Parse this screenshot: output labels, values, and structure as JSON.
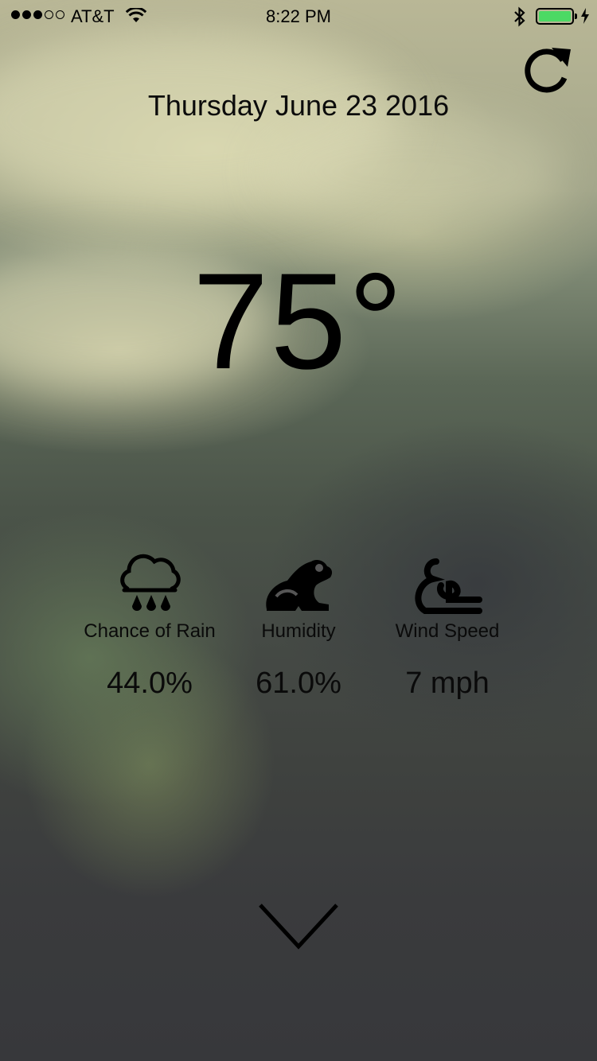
{
  "status_bar": {
    "signal_dots_filled": 3,
    "signal_dots_total": 5,
    "carrier": "AT&T",
    "time": "8:22 PM",
    "battery_level": 1.0,
    "battery_color": "#4cd964",
    "icons": [
      "wifi-icon",
      "bluetooth-icon",
      "battery-icon",
      "charging-bolt-icon"
    ]
  },
  "header": {
    "refresh_icon": "refresh-icon",
    "date": "Thursday June 23 2016"
  },
  "current": {
    "temperature": "75°"
  },
  "metrics": [
    {
      "icon": "rain-cloud-icon",
      "label": "Chance of Rain",
      "value": "44.0%"
    },
    {
      "icon": "frog-icon",
      "label": "Humidity",
      "value": "61.0%"
    },
    {
      "icon": "wind-icon",
      "label": "Wind Speed",
      "value": "7 mph"
    }
  ],
  "footer": {
    "expand_icon": "chevron-down-icon"
  }
}
